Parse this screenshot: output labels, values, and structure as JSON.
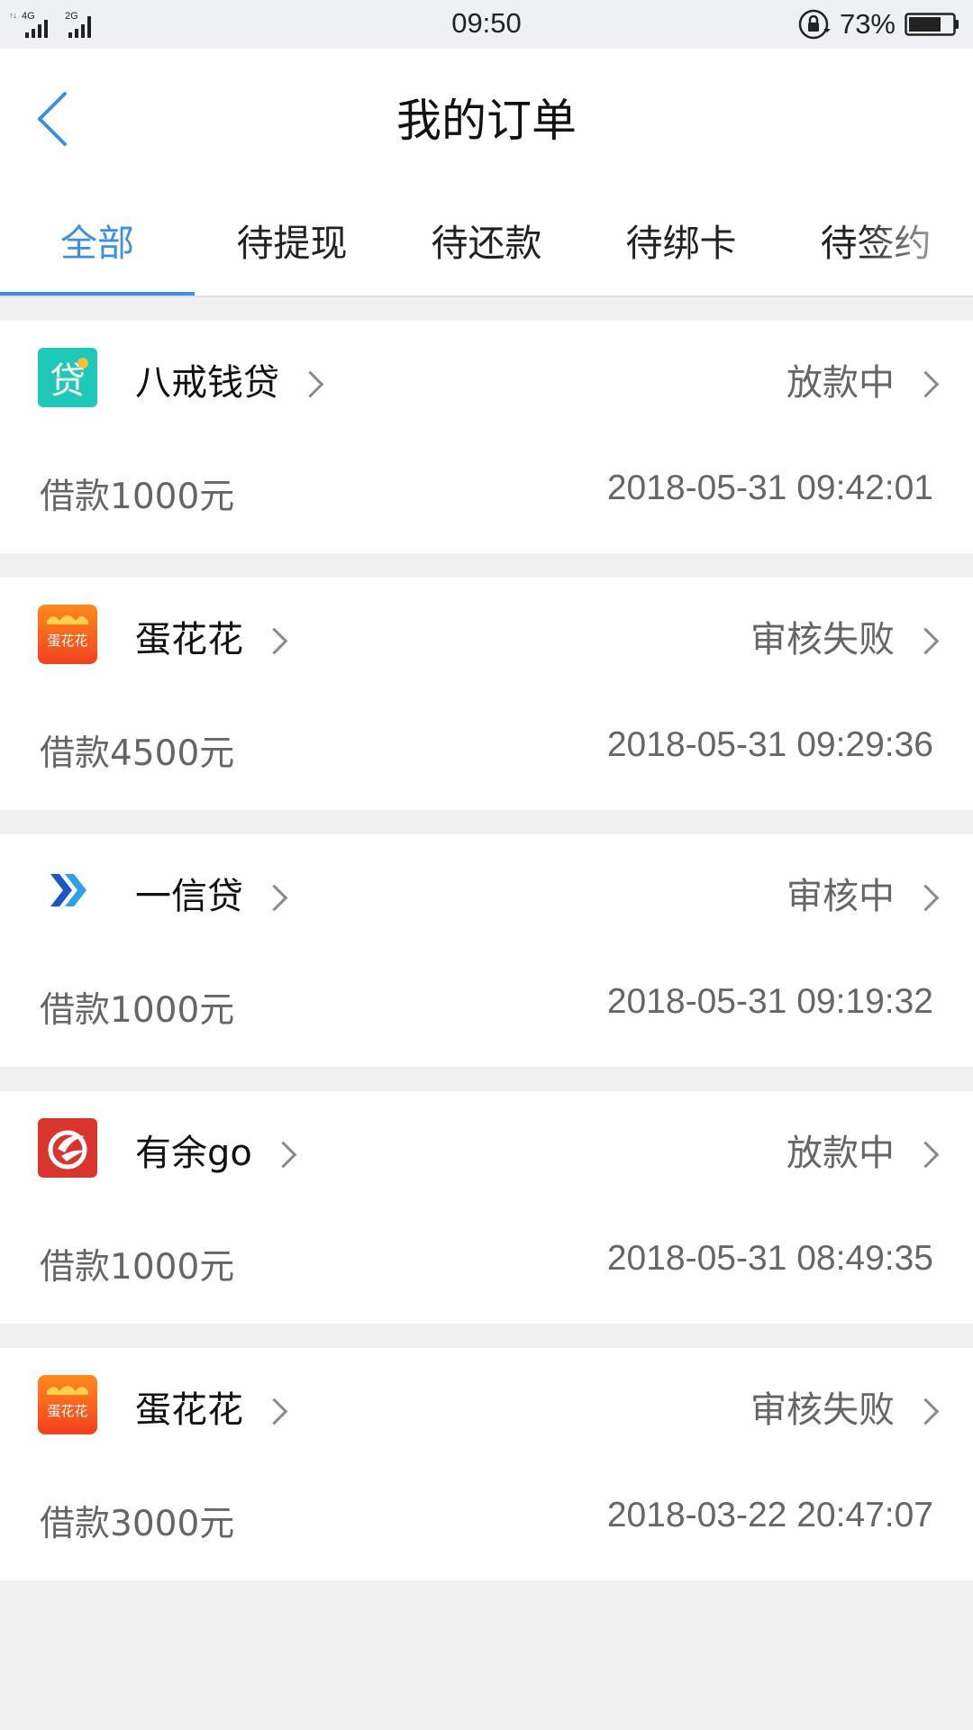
{
  "status_bar": {
    "network_1": "4G",
    "network_2": "2G",
    "time": "09:50",
    "battery": "73%"
  },
  "header": {
    "title": "我的订单"
  },
  "tabs": [
    {
      "label": "全部",
      "active": true
    },
    {
      "label": "待提现",
      "active": false
    },
    {
      "label": "待还款",
      "active": false
    },
    {
      "label": "待绑卡",
      "active": false
    },
    {
      "label": "待签约",
      "active": false
    }
  ],
  "orders": [
    {
      "app": "八戒钱贷",
      "status": "放款中",
      "amount": "借款1000元",
      "datetime": "2018-05-31 09:42:01",
      "logo": "teal-loan-icon"
    },
    {
      "app": "蛋花花",
      "status": "审核失败",
      "amount": "借款4500元",
      "datetime": "2018-05-31 09:29:36",
      "logo": "danhuahua-icon",
      "logo_text": "蛋花花"
    },
    {
      "app": "一信贷",
      "status": "审核中",
      "amount": "借款1000元",
      "datetime": "2018-05-31 09:19:32",
      "logo": "yixindai-icon"
    },
    {
      "app": "有余go",
      "status": "放款中",
      "amount": "借款1000元",
      "datetime": "2018-05-31 08:49:35",
      "logo": "youyugo-icon"
    },
    {
      "app": "蛋花花",
      "status": "审核失败",
      "amount": "借款3000元",
      "datetime": "2018-03-22 20:47:07",
      "logo": "danhuahua-icon",
      "logo_text": "蛋花花"
    }
  ],
  "colors": {
    "accent": "#3d8ee0",
    "background": "#f0f0f0",
    "card": "#ffffff"
  }
}
